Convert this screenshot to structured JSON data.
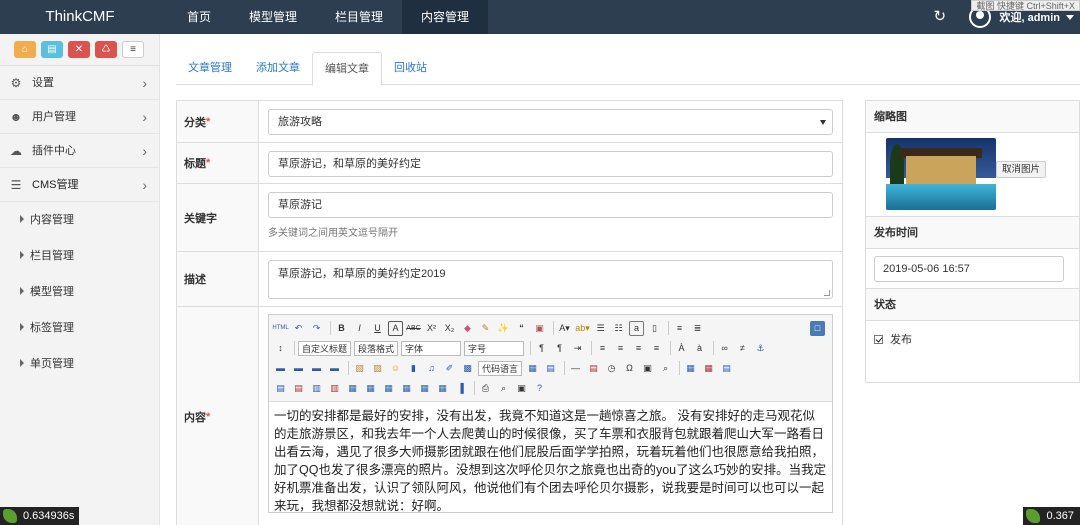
{
  "brand": "ThinkCMF",
  "nav": [
    "首页",
    "模型管理",
    "栏目管理",
    "内容管理"
  ],
  "topright": {
    "welcome": "欢迎, admin",
    "tip": "截图 快捷键 Ctrl+Shift+X"
  },
  "sidebar": {
    "menu": [
      {
        "label": "设置",
        "icon": "gears-icon"
      },
      {
        "label": "用户管理",
        "icon": "users-icon"
      },
      {
        "label": "插件中心",
        "icon": "cloud-icon"
      },
      {
        "label": "CMS管理",
        "icon": "list-icon"
      }
    ],
    "sub": [
      "内容管理",
      "栏目管理",
      "模型管理",
      "标签管理",
      "单页管理"
    ]
  },
  "tabs": [
    "文章管理",
    "添加文章",
    "编辑文章",
    "回收站"
  ],
  "form": {
    "category_label": "分类",
    "category_value": "旅游攻略",
    "title_label": "标题",
    "title_value": "草原游记，和草原的美好约定",
    "keywords_label": "关键字",
    "keywords_value": "草原游记",
    "keywords_help": "多关键词之间用英文逗号隔开",
    "desc_label": "描述",
    "desc_value": "草原游记，和草原的美好约定2019",
    "content_label": "内容",
    "content_text": "一切的安排都是最好的安排，没有出发，我竟不知道这是一趟惊喜之旅。 没有安排好的走马观花似的走旅游景区，和我去年一个人去爬黄山的时候很像，买了车票和衣服背包就跟着爬山大军一路看日出看云海，遇见了很多大师摄影团就跟在他们屁股后面学学拍照，玩着玩着他们也很愿意给我拍照，加了QQ也发了很多漂亮的照片。没想到这次呼伦贝尔之旅竟也出奇的you了这么巧妙的安排。当我定好机票准备出发，认识了领队阿风，他说他们有个团去呼伦贝尔摄影，说我要是时间可以也可以一起来玩，我想都没想就说：好啊。"
  },
  "editor": {
    "combo_heading": "自定义标题",
    "combo_para": "段落格式",
    "combo_font": "字体",
    "combo_size": "字号",
    "combo_code": "代码语言"
  },
  "right": {
    "thumb_label": "缩略图",
    "cancel_btn": "取消图片",
    "pubtime_label": "发布时间",
    "pubtime_value": "2019-05-06 16:57",
    "status_label": "状态",
    "publish_label": "发布"
  },
  "debug": {
    "left": "0.634936s",
    "right": "0.367"
  }
}
